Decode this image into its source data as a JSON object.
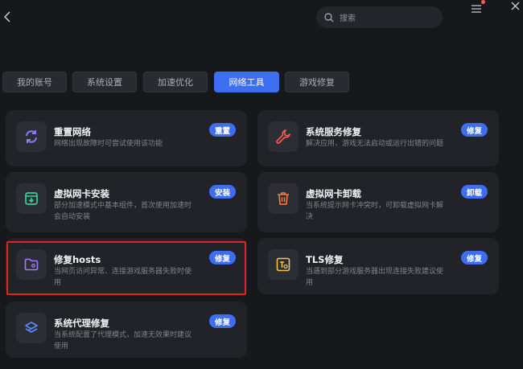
{
  "header": {
    "search_placeholder": "搜索",
    "colors": {
      "accent": "#3d6ef2",
      "notice_dot": "#ff5a4e",
      "highlight": "#e0241f"
    }
  },
  "tabs": [
    {
      "label": "我的账号"
    },
    {
      "label": "系统设置"
    },
    {
      "label": "加速优化"
    },
    {
      "label": "网络工具",
      "active": true
    },
    {
      "label": "游戏修复"
    }
  ],
  "cards": [
    {
      "id": "reset-network",
      "icon": "refresh-icon",
      "title": "重置网络",
      "desc": "网络出现故障时可尝试使用该功能",
      "button": "重置"
    },
    {
      "id": "system-service-repair",
      "icon": "wrench-icon",
      "title": "系统服务修复",
      "desc": "解决应用、游戏无法启动或运行出错的问题",
      "button": "修复"
    },
    {
      "id": "virtual-nic-install",
      "icon": "download-box-icon",
      "title": "虚拟网卡安装",
      "desc": "部分加速模式中基本组件，首次使用加速时会自动安装",
      "button": "安装"
    },
    {
      "id": "virtual-nic-uninstall",
      "icon": "trash-icon",
      "title": "虚拟网卡卸载",
      "desc": "当系统提示网卡冲突时，可卸载虚拟网卡解决",
      "button": "卸载"
    },
    {
      "id": "repair-hosts",
      "icon": "folder-icon",
      "title": "修复hosts",
      "desc": "当网页访问异常、连接游戏服务器失败时使用",
      "button": "修复"
    },
    {
      "id": "tls-repair",
      "icon": "tls-icon",
      "title": "TLS修复",
      "desc": "当遇到部分游戏服务器出现连接失败建议使用",
      "button": "修复"
    },
    {
      "id": "system-proxy-repair",
      "icon": "layers-icon",
      "title": "系统代理修复",
      "desc": "当系统配置了代理模式，加速无效果时建议使用",
      "button": "修复"
    }
  ]
}
